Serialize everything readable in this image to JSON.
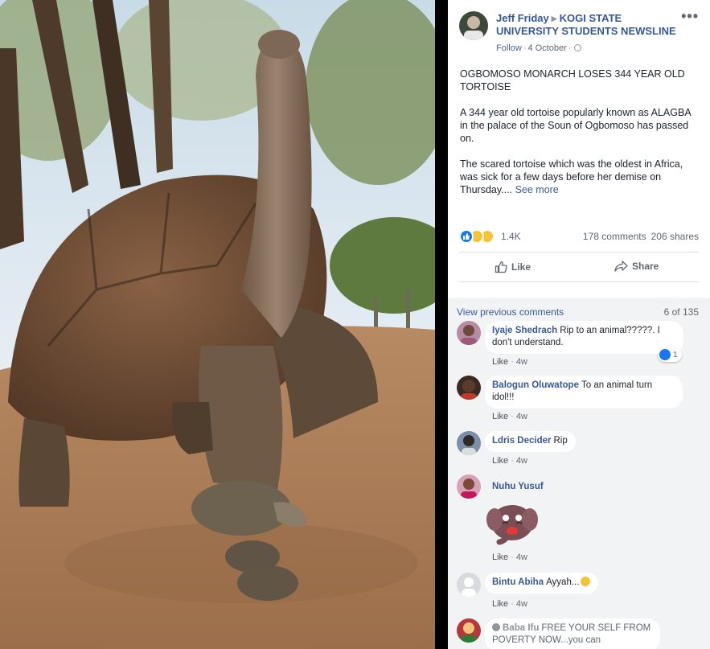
{
  "post": {
    "author": "Jeff Friday",
    "group": "KOGI STATE UNIVERSITY STUDENTS NEWSLINE",
    "follow": "Follow",
    "date": "4 October",
    "more_label": "•••",
    "headline": "OGBOMOSO MONARCH LOSES 344 YEAR OLD TORTOISE",
    "paragraph1": "A 344 year old tortoise popularly known as ALAGBA in the palace of the Soun of Ogbomoso has passed on.",
    "paragraph2": "The scared tortoise which was the oldest in Africa, was sick for a few days before her demise on Thursday....",
    "see_more": "See more"
  },
  "reactions": {
    "count": "1.4K",
    "comments": "178 comments",
    "shares": "206 shares",
    "icons": [
      "like-reaction-icon",
      "sad-reaction-icon",
      "haha-reaction-icon"
    ]
  },
  "actions": {
    "like_label": "Like",
    "share_label": "Share"
  },
  "comments_section": {
    "view_previous": "View previous comments",
    "counter": "6 of 135",
    "like_label": "Like",
    "items": [
      {
        "author": "Iyaje Shedrach",
        "text": "Rip to an animal?????. I don't understand.",
        "time": "4w",
        "reaction_count": "1"
      },
      {
        "author": "Balogun Oluwatope",
        "text": "To an animal turn idol!!!",
        "time": "4w"
      },
      {
        "author": "Ldris Decider",
        "text": "Rip",
        "time": "4w"
      },
      {
        "author": "Nuhu Yusuf",
        "text": "",
        "time": "4w",
        "sticker": "crying-elephant-sticker"
      },
      {
        "author": "Bintu Abiha",
        "text": "Ayyah...",
        "time": "4w"
      },
      {
        "author": "Baba Ifu",
        "text": "FREE YOUR SELF FROM POVERTY NOW...you can"
      }
    ]
  },
  "colors": {
    "link_blue": "#385898",
    "name_blue": "#365899",
    "like_blue": "#1877f2",
    "comments_bg": "#f2f3f5"
  }
}
